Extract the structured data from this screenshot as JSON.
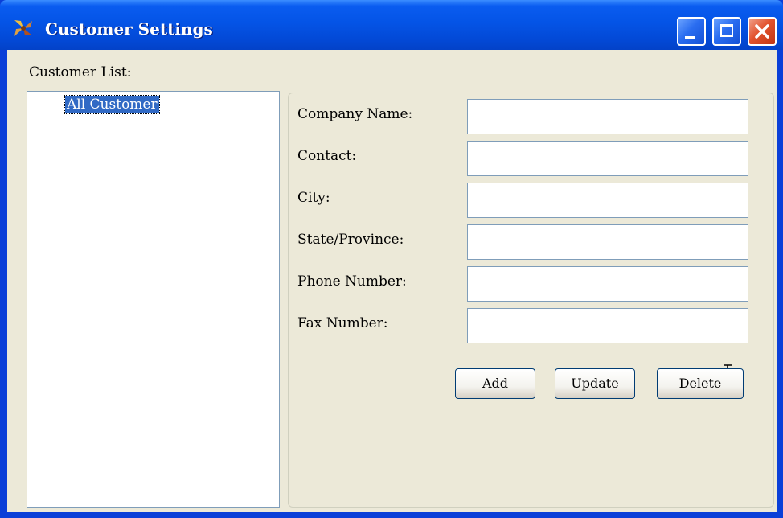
{
  "window": {
    "title": "Customer Settings",
    "app_icon": "pinwheel-icon",
    "controls": [
      "minimize-icon",
      "maximize-icon",
      "close-icon"
    ]
  },
  "customer_list": {
    "label": "Customer List:",
    "tree_items": [
      {
        "label": "All Customer",
        "selected": true
      }
    ]
  },
  "form": {
    "fields": [
      {
        "label": "Company Name:",
        "value": ""
      },
      {
        "label": "Contact:",
        "value": ""
      },
      {
        "label": "City:",
        "value": ""
      },
      {
        "label": "State/Province:",
        "value": ""
      },
      {
        "label": "Phone Number:",
        "value": ""
      },
      {
        "label": "Fax Number:",
        "value": ""
      }
    ],
    "buttons": {
      "add": "Add",
      "update": "Update",
      "delete": "Delete"
    }
  },
  "colors": {
    "titlebar": "#0454e6",
    "client_bg": "#ece9d8",
    "selection": "#316ac5",
    "close_button": "#e2532e"
  }
}
